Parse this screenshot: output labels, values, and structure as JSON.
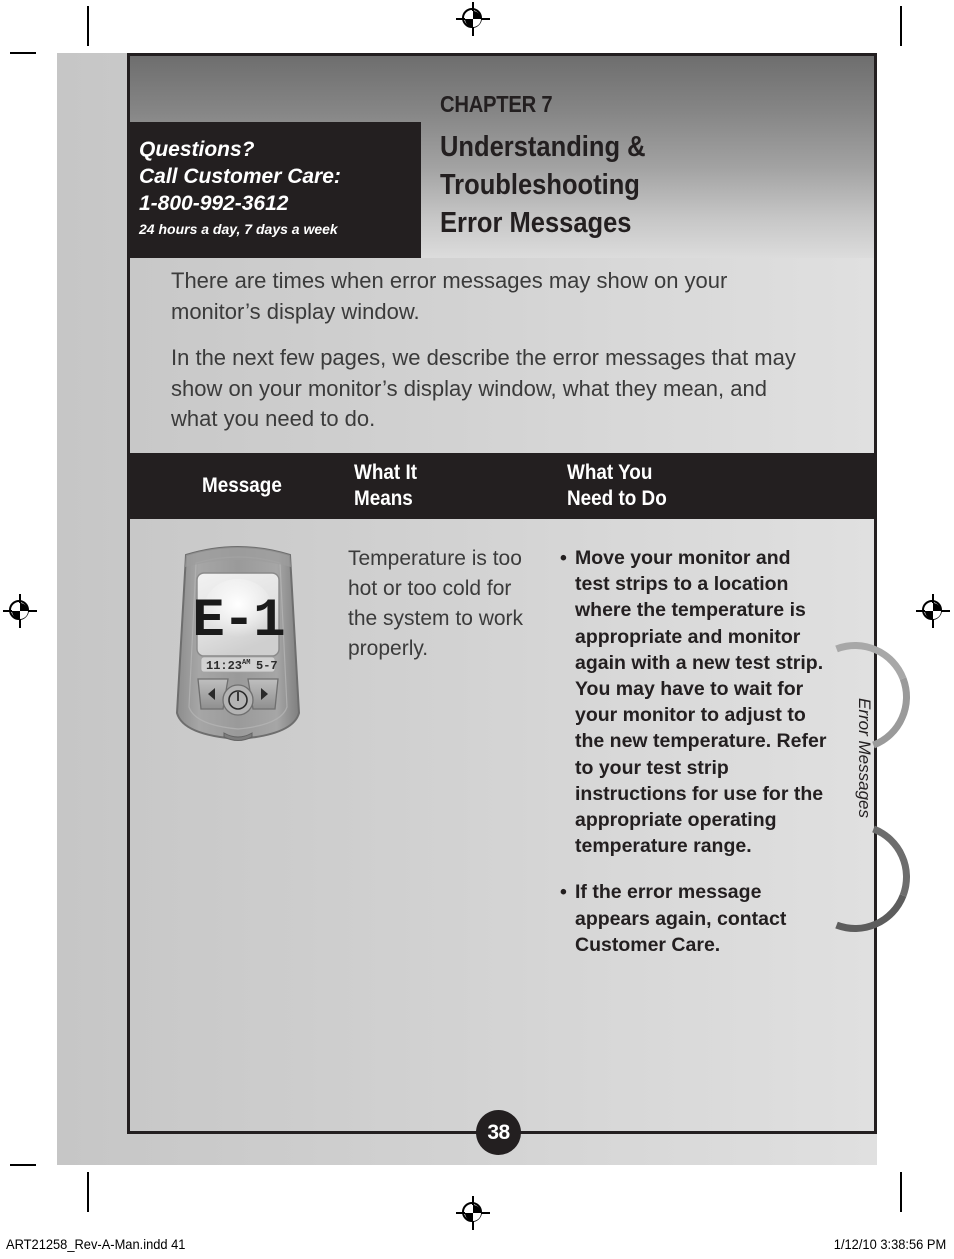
{
  "header": {
    "chapter_label": "CHAPTER 7",
    "chapter_title": "Understanding &\nTroubleshooting\nError Messages"
  },
  "questions_box": {
    "line1": "Questions?",
    "line2": "Call Customer Care:",
    "line3": "1-800-992-3612",
    "hours": "24 hours a day, 7 days a week"
  },
  "intro": {
    "paragraph1": "There are times when error messages may show on your monitor’s display window.",
    "paragraph2": "In the next few pages, we describe the error messages that may show on your monitor’s display window, what they mean, and what you need to do."
  },
  "table": {
    "headers": {
      "message": "Message",
      "means": "What It\nMeans",
      "todo": "What You\nNeed to Do"
    },
    "row": {
      "monitor": {
        "display_code": "E-1",
        "time": "11:23",
        "meridiem": "AM",
        "secondary": "5-7",
        "left_arrow": "◀",
        "right_arrow": "▶",
        "power_symbol": "⓪"
      },
      "means": "Temperature is too hot or too cold for the system to work properly.",
      "todo_bullets": [
        "Move your monitor and test strips to a location where the temperature is appropriate and monitor again with a new test strip. You may have to wait for your monitor to adjust to the new temperature. Refer to your test strip instructions for use for the appropriate operating temperature range.",
        "If the error message appears again, contact Customer Care."
      ],
      "bullet_glyph": "•"
    }
  },
  "side_tab": {
    "label": "Error Messages"
  },
  "page": {
    "number": "38"
  },
  "footer": {
    "left": "ART21258_Rev-A-Man.indd   41",
    "right": "1/12/10   3:38:56 PM"
  },
  "colors": {
    "ink": "#231f20",
    "body_text": "#3b3b3b",
    "paper": "#ffffff",
    "bleed": "#cfcfcf"
  }
}
